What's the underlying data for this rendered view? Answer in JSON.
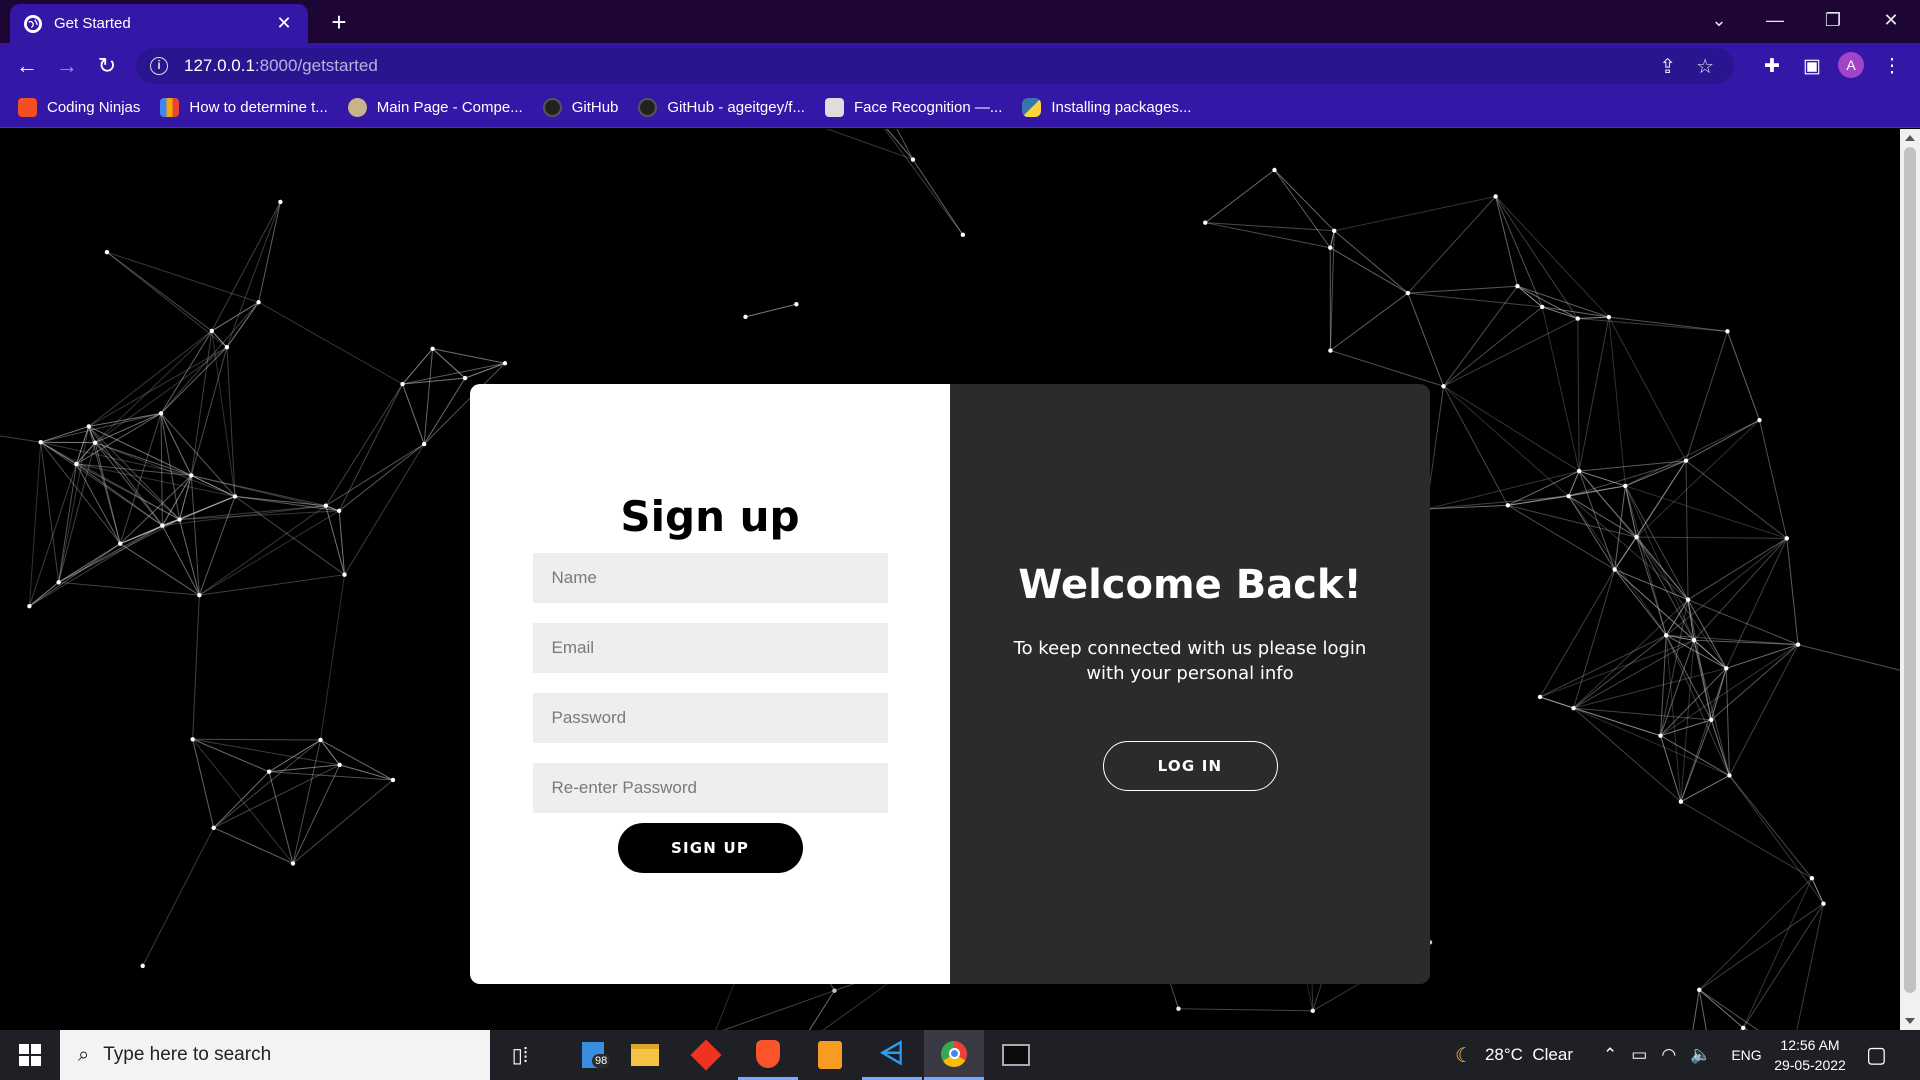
{
  "browser": {
    "tab_title": "Get Started",
    "tab_close": "✕",
    "new_tab": "+",
    "url_host": "127.0.0.1",
    "url_path": ":8000/getstarted",
    "profile_initial": "A"
  },
  "bookmarks": [
    {
      "label": "Coding Ninjas",
      "icon": "coding-ninjas-icon",
      "color": "#f25022"
    },
    {
      "label": "How to determine t...",
      "icon": "bar-chart-icon",
      "color": "#f2a900"
    },
    {
      "label": "Main Page - Compe...",
      "icon": "wiki-icon",
      "color": "#c9b48a"
    },
    {
      "label": "GitHub",
      "icon": "github-icon",
      "color": "#222222"
    },
    {
      "label": "GitHub - ageitgey/f...",
      "icon": "github-icon",
      "color": "#222222"
    },
    {
      "label": "Face Recognition —...",
      "icon": "book-icon",
      "color": "#dddddd"
    },
    {
      "label": "Installing packages...",
      "icon": "python-icon",
      "color": "#3776ab"
    }
  ],
  "signup": {
    "heading": "Sign up",
    "name_placeholder": "Name",
    "email_placeholder": "Email",
    "password_placeholder": "Password",
    "repassword_placeholder": "Re-enter Password",
    "button": "SIGN UP"
  },
  "welcome": {
    "heading": "Welcome Back!",
    "text": "To keep connected with us please login with your personal info",
    "button": "LOG IN"
  },
  "taskbar": {
    "search_placeholder": "Type here to search",
    "badge_count": "98",
    "weather": "28°C  Clear",
    "language": "ENG",
    "time": "12:56 AM",
    "date": "29-05-2022"
  },
  "colors": {
    "browser_frame": "#3517a8",
    "tabbar": "#1d0534",
    "panel_dark": "#2b2c2a",
    "field_bg": "#eeeeee"
  }
}
